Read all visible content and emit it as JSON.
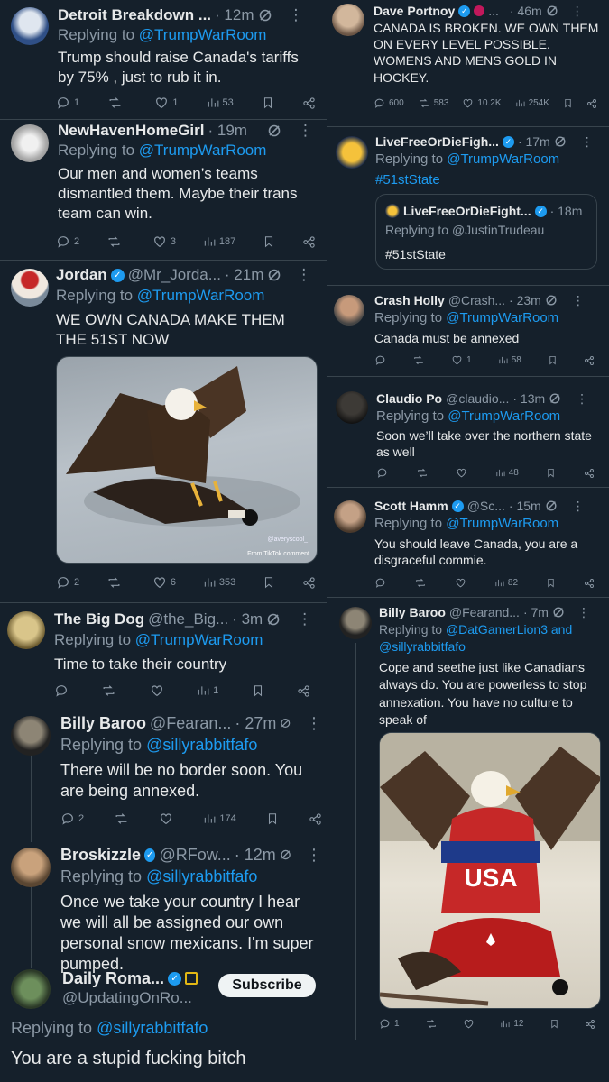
{
  "left": {
    "t1": {
      "name": "Detroit Breakdown ...",
      "time": "· 12m",
      "reply_prefix": "Replying to",
      "reply_to": "@TrumpWarRoom",
      "text": "Trump should raise Canada's tariffs by 75% , just to rub it in.",
      "replies": "1",
      "reposts": "",
      "likes": "1",
      "views": "53"
    },
    "t2": {
      "name": "NewHavenHomeGirl",
      "time": "· 19m",
      "reply_prefix": "Replying to",
      "reply_to": "@TrumpWarRoom",
      "text": "Our men and women’s teams dismantled them. Maybe their trans team can win.",
      "replies": "2",
      "reposts": "",
      "likes": "3",
      "views": "187"
    },
    "t3": {
      "name": "Jordan",
      "handle": "@Mr_Jorda...",
      "time": "· 21m",
      "reply_prefix": "Replying to",
      "reply_to": "@TrumpWarRoom",
      "text": "WE OWN CANADA MAKE THEM THE 51ST NOW",
      "media_watermark": "@averyscool_",
      "media_source": "From TikTok comment",
      "replies": "2",
      "reposts": "",
      "likes": "6",
      "views": "353"
    },
    "t4": {
      "name": "The Big Dog",
      "handle": "@the_Big...",
      "time": "· 3m",
      "reply_prefix": "Replying to",
      "reply_to": "@TrumpWarRoom",
      "text": "Time to take their country",
      "replies": "",
      "reposts": "",
      "likes": "",
      "views": "1"
    },
    "t5": {
      "name": "Billy Baroo",
      "handle": "@Fearan...",
      "time": "· 27m",
      "reply_prefix": "Replying to",
      "reply_to": "@sillyrabbitfafo",
      "text": "There will be no border soon. You are being annexed.",
      "replies": "2",
      "reposts": "",
      "likes": "",
      "views": "174"
    },
    "t6": {
      "name": "Broskizzle",
      "handle": "@RFow...",
      "time": "· 12m",
      "reply_prefix": "Replying to",
      "reply_to": "@sillyrabbitfafo",
      "text": "Once we take your country I hear we will all be assigned our own personal snow mexicans. I'm super pumped."
    },
    "t7": {
      "name": "Daily Roma...",
      "handle": "@UpdatingOnRo...",
      "subscribe": "Subscribe",
      "reply_prefix": "Replying to",
      "reply_to": "@sillyrabbitfafo",
      "text": "You are a stupid fucking bitch"
    }
  },
  "right": {
    "r1": {
      "name": "Dave Portnoy",
      "handle": "...",
      "time": "· 46m",
      "text": "CANADA IS BROKEN.     WE OWN THEM ON EVERY LEVEL POSSIBLE. WOMENS AND MENS GOLD IN HOCKEY.",
      "replies": "600",
      "reposts": "583",
      "likes": "10.2K",
      "views": "254K"
    },
    "r2": {
      "name": "LiveFreeOrDieFigh...",
      "time": "· 17m",
      "reply_prefix": "Replying to",
      "reply_to": "@TrumpWarRoom",
      "text": "#51stState",
      "quote": {
        "name": "LiveFreeOrDieFight...",
        "time": "· 18m",
        "reply_prefix": "Replying to",
        "reply_to": "@JustinTrudeau",
        "text": "#51stState"
      }
    },
    "r3": {
      "name": "Crash Holly",
      "handle": "@Crash...",
      "time": "· 23m",
      "reply_prefix": "Replying to",
      "reply_to": "@TrumpWarRoom",
      "text": "Canada must be annexed",
      "replies": "",
      "reposts": "",
      "likes": "1",
      "views": "58"
    },
    "r4": {
      "name": "Claudio Po",
      "handle": "@claudio...",
      "time": "· 13m",
      "reply_prefix": "Replying to",
      "reply_to": "@TrumpWarRoom",
      "text": "Soon we’ll take over the northern state as well",
      "replies": "",
      "reposts": "",
      "likes": "",
      "views": "48"
    },
    "r5": {
      "name": "Scott Hamm",
      "handle": "@Sc...",
      "time": "· 15m",
      "reply_prefix": "Replying to",
      "reply_to": "@TrumpWarRoom",
      "text": "You should leave Canada, you are a disgraceful commie.",
      "replies": "",
      "reposts": "",
      "likes": "",
      "views": "82"
    },
    "r6": {
      "name": "Billy Baroo",
      "handle": "@Fearand...",
      "time": "· 7m",
      "reply_prefix": "Replying to",
      "reply_to": "@DatGamerLion3 and @sillyrabbitfafo",
      "text": "Cope and seethe just like Canadians always do. You are powerless to stop annexation. You have no culture to speak of",
      "media_text": "USA",
      "replies": "1",
      "reposts": "",
      "likes": "",
      "views": "12"
    }
  }
}
